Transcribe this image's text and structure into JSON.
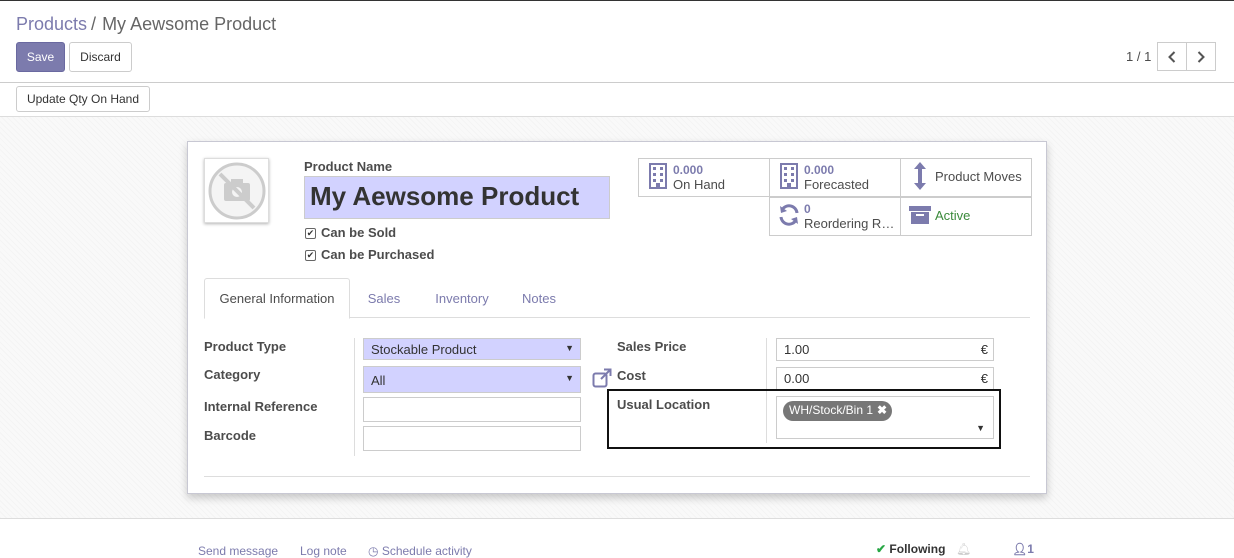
{
  "breadcrumb": {
    "parent": "Products",
    "separator": "/",
    "current": "My Aewsome Product"
  },
  "actions": {
    "save": "Save",
    "discard": "Discard"
  },
  "pager": {
    "value": "1 / 1"
  },
  "statusbar": {
    "update_qty": "Update Qty On Hand"
  },
  "form": {
    "product_name_label": "Product Name",
    "product_name": "My Aewsome Product",
    "can_be_sold": "Can be Sold",
    "can_be_purchased": "Can be Purchased",
    "can_be_sold_checked": true,
    "can_be_purchased_checked": true
  },
  "smart_buttons": {
    "on_hand": {
      "value": "0.000",
      "label": "On Hand"
    },
    "forecasted": {
      "value": "0.000",
      "label": "Forecasted"
    },
    "product_moves": {
      "label": "Product Moves"
    },
    "reordering": {
      "value": "0",
      "label": "Reordering R…"
    },
    "active": {
      "label": "Active",
      "color": "#3a8a3a"
    }
  },
  "tabs": [
    "General Information",
    "Sales",
    "Inventory",
    "Notes"
  ],
  "general": {
    "product_type_label": "Product Type",
    "product_type_value": "Stockable Product",
    "category_label": "Category",
    "category_value": "All",
    "internal_reference_label": "Internal Reference",
    "internal_reference_value": "",
    "barcode_label": "Barcode",
    "barcode_value": "",
    "sales_price_label": "Sales Price",
    "sales_price_value": "1.00",
    "cost_label": "Cost",
    "cost_value": "0.00",
    "currency_symbol": "€",
    "usual_location_label": "Usual Location",
    "usual_location_tag": "WH/Stock/Bin 1"
  },
  "chatter": {
    "send_message": "Send message",
    "log_note": "Log note",
    "schedule_activity": "Schedule activity",
    "following": "Following",
    "followers_count": "1"
  },
  "colors": {
    "brand": "#7c7bad",
    "required_field": "#d2d2ff"
  }
}
